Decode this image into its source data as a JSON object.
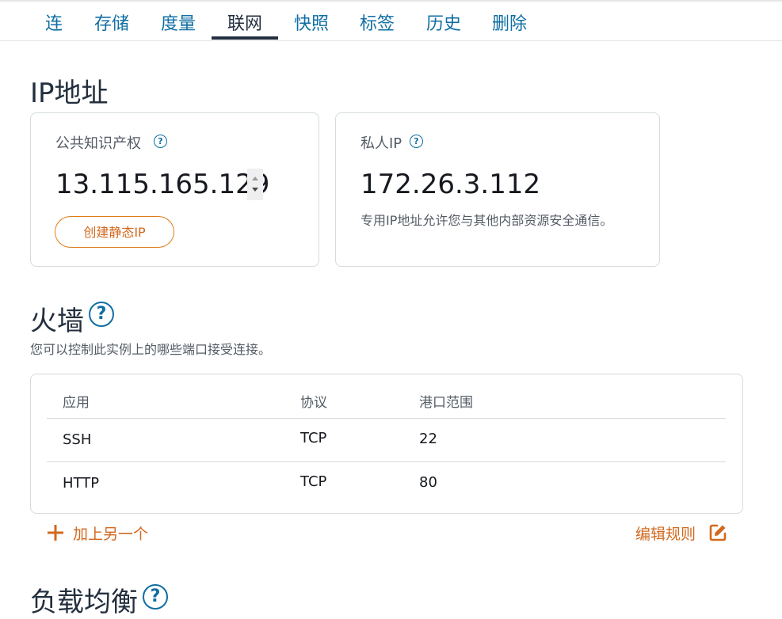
{
  "tabs": [
    {
      "label": "连"
    },
    {
      "label": "存储"
    },
    {
      "label": "度量"
    },
    {
      "label": "联网"
    },
    {
      "label": "快照"
    },
    {
      "label": "标签"
    },
    {
      "label": "历史"
    },
    {
      "label": "删除"
    }
  ],
  "active_tab": "联网",
  "ip_section": {
    "title": "IP地址",
    "public": {
      "label": "公共知识产权",
      "value": "13.115.165.129",
      "button": "创建静态IP"
    },
    "private": {
      "label": "私人IP",
      "value": "172.26.3.112",
      "description": "专用IP地址允许您与其他内部资源安全通信。"
    }
  },
  "firewall": {
    "title": "火墙",
    "description": "您可以控制此实例上的哪些端口接受连接。",
    "columns": [
      "应用",
      "协议",
      "港口范围"
    ],
    "rows": [
      {
        "app": "SSH",
        "protocol": "TCP",
        "port": "22"
      },
      {
        "app": "HTTP",
        "protocol": "TCP",
        "port": "80"
      }
    ],
    "add_label": "加上另一个",
    "edit_label": "编辑规则"
  },
  "load_balancing": {
    "title": "负载均衡"
  },
  "help_glyph": "?",
  "colors": {
    "link": "#0f6ea3",
    "accent": "#d2691e",
    "text": "#232f3e"
  }
}
